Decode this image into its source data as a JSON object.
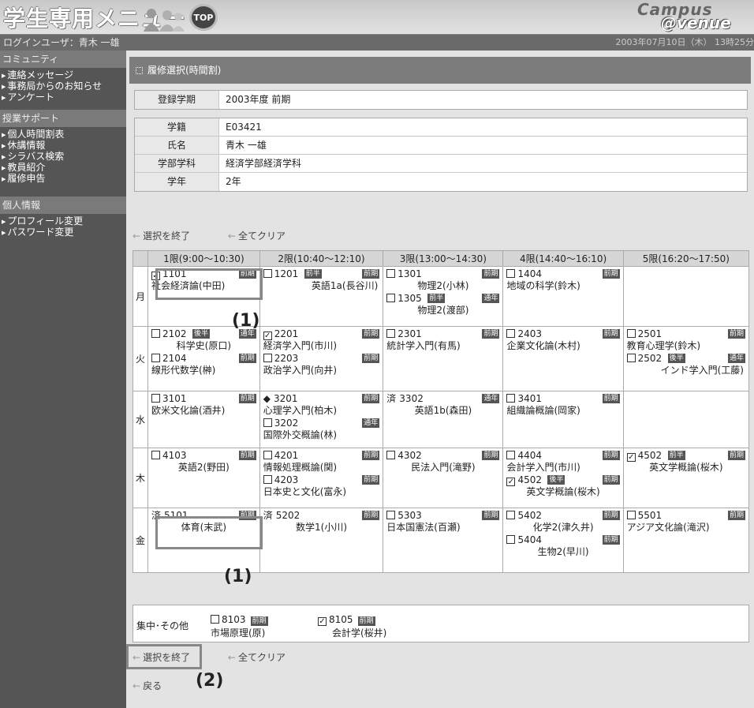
{
  "header": {
    "title": "学生専用メニュー",
    "top_label": "TOP",
    "logo_line1": "Campus",
    "logo_line2": "@venue"
  },
  "userbar": {
    "user": "ログインユーザ：青木 一雄",
    "datetime": "2003年07月10日（木） 13時25分"
  },
  "sidebar": [
    {
      "category": "コミュニティ",
      "items": [
        "連絡メッセージ",
        "事務局からのお知らせ",
        "アンケート"
      ]
    },
    {
      "category": "授業サポート",
      "items": [
        "個人時間割表",
        "休講情報",
        "シラバス検索",
        "教員紹介",
        "履修申告"
      ]
    },
    {
      "category": "個人情報",
      "items": [
        "プロフィール変更",
        "パスワード変更"
      ]
    }
  ],
  "page_title": "履修選択(時間割)",
  "term": {
    "label": "登録学期",
    "value": "2003年度 前期"
  },
  "student": [
    {
      "label": "学籍",
      "value": "E03421"
    },
    {
      "label": "氏名",
      "value": "青木 一雄"
    },
    {
      "label": "学部学科",
      "value": "経済学部経済学科"
    },
    {
      "label": "学年",
      "value": "2年"
    }
  ],
  "actions": {
    "finish": "選択を終了",
    "clear": "全てクリア",
    "back": "戻る"
  },
  "periods": [
    "1限(9:00〜10:30)",
    "2限(10:40〜12:10)",
    "3限(13:00〜14:30)",
    "4限(14:40〜16:10)",
    "5限(16:20〜17:50)"
  ],
  "days": [
    "月",
    "火",
    "水",
    "木",
    "金"
  ],
  "other": {
    "label": "集中･その他",
    "entries": [
      {
        "code": "8103",
        "tag": "前期",
        "name": "市場原理(原)",
        "checked": false
      },
      {
        "code": "8105",
        "tag": "前期",
        "name": "会計学(桜井)",
        "checked": true
      }
    ]
  },
  "annotations": {
    "a1": "(1)",
    "a2": "(1)",
    "a3": "(2)"
  },
  "timetable": [
    [
      [
        {
          "mark": "checked",
          "code": "1101",
          "tag": "前期",
          "name": "社会経済論(中田)",
          "align": "left"
        }
      ],
      [
        {
          "mark": "box",
          "code": "1201",
          "mid": "前半",
          "tag": "前期",
          "name": "英語1a(長谷川)",
          "align": "right"
        }
      ],
      [
        {
          "mark": "box",
          "code": "1301",
          "tag": "前期",
          "name": "物理2(小林)",
          "align": "center"
        },
        {
          "mark": "box",
          "code": "1305",
          "mid": "前半",
          "tag": "通年",
          "name": "物理2(渡部)",
          "align": "center"
        }
      ],
      [
        {
          "mark": "box",
          "code": "1404",
          "tag": "前期",
          "name": "地域の科学(鈴木)",
          "align": "left"
        }
      ],
      []
    ],
    [
      [
        {
          "mark": "box",
          "code": "2102",
          "mid": "後半",
          "tag": "通年",
          "name": "科学史(原口)",
          "align": "center"
        },
        {
          "mark": "box",
          "code": "2104",
          "tag": "前期",
          "name": "線形代数学(榊)",
          "align": "left"
        }
      ],
      [
        {
          "mark": "checked",
          "code": "2201",
          "tag": "前期",
          "name": "経済学入門(市川)",
          "align": "left"
        },
        {
          "mark": "box",
          "code": "2203",
          "tag": "前期",
          "name": "政治学入門(向井)",
          "align": "left"
        }
      ],
      [
        {
          "mark": "box",
          "code": "2301",
          "tag": "前期",
          "name": "統計学入門(有馬)",
          "align": "left"
        }
      ],
      [
        {
          "mark": "box",
          "code": "2403",
          "tag": "前期",
          "name": "企業文化論(木村)",
          "align": "left"
        }
      ],
      [
        {
          "mark": "box",
          "code": "2501",
          "tag": "前期",
          "name": "教育心理学(鈴木)",
          "align": "left"
        },
        {
          "mark": "box",
          "code": "2502",
          "mid": "後半",
          "tag": "通年",
          "name": "インド学入門(工藤)",
          "align": "right"
        }
      ]
    ],
    [
      [
        {
          "mark": "box",
          "code": "3101",
          "tag": "前期",
          "name": "欧米文化論(酒井)",
          "align": "left"
        }
      ],
      [
        {
          "mark": "◆",
          "code": "3201",
          "tag": "前期",
          "name": "心理学入門(柏木)",
          "align": "left"
        },
        {
          "mark": "box",
          "code": "3202",
          "tag": "通年",
          "name": "国際外交概論(林)",
          "align": "left"
        }
      ],
      [
        {
          "mark": "済",
          "code": "3302",
          "tag": "通年",
          "name": "英語1b(森田)",
          "align": "center"
        }
      ],
      [
        {
          "mark": "box",
          "code": "3401",
          "tag": "前期",
          "name": "組織論概論(岡家)",
          "align": "left"
        }
      ],
      []
    ],
    [
      [
        {
          "mark": "box",
          "code": "4103",
          "tag": "前期",
          "name": "英語2(野田)",
          "align": "center"
        }
      ],
      [
        {
          "mark": "box",
          "code": "4201",
          "tag": "前期",
          "name": "情報処理概論(関)",
          "align": "left"
        },
        {
          "mark": "box",
          "code": "4203",
          "tag": "前期",
          "name": "日本史と文化(富永)",
          "align": "left"
        }
      ],
      [
        {
          "mark": "box",
          "code": "4302",
          "tag": "前期",
          "name": "民法入門(滝野)",
          "align": "center"
        }
      ],
      [
        {
          "mark": "box",
          "code": "4404",
          "tag": "前期",
          "name": "会計学入門(市川)",
          "align": "left"
        },
        {
          "mark": "checked",
          "code": "4502",
          "mid": "後半",
          "tag": "前期",
          "name": "英文学概論(桜木)",
          "align": "center"
        }
      ],
      [
        {
          "mark": "checked",
          "code": "4502",
          "mid": "前半",
          "tag": "前期",
          "name": "英文学概論(桜木)",
          "align": "center"
        }
      ]
    ],
    [
      [
        {
          "mark": "済",
          "code": "5101",
          "tag": "前期",
          "name": "体育(末武)",
          "align": "center"
        }
      ],
      [
        {
          "mark": "済",
          "code": "5202",
          "tag": "前期",
          "name": "数学1(小川)",
          "align": "center"
        }
      ],
      [
        {
          "mark": "box",
          "code": "5303",
          "tag": "前期",
          "name": "日本国憲法(百瀬)",
          "align": "left"
        }
      ],
      [
        {
          "mark": "box",
          "code": "5402",
          "tag": "前期",
          "name": "化学2(津久井)",
          "align": "center"
        },
        {
          "mark": "box",
          "code": "5404",
          "tag": "前期",
          "name": "生物2(早川)",
          "align": "center"
        }
      ],
      [
        {
          "mark": "box",
          "code": "5501",
          "tag": "前期",
          "name": "アジア文化論(滝沢)",
          "align": "left"
        }
      ]
    ]
  ]
}
